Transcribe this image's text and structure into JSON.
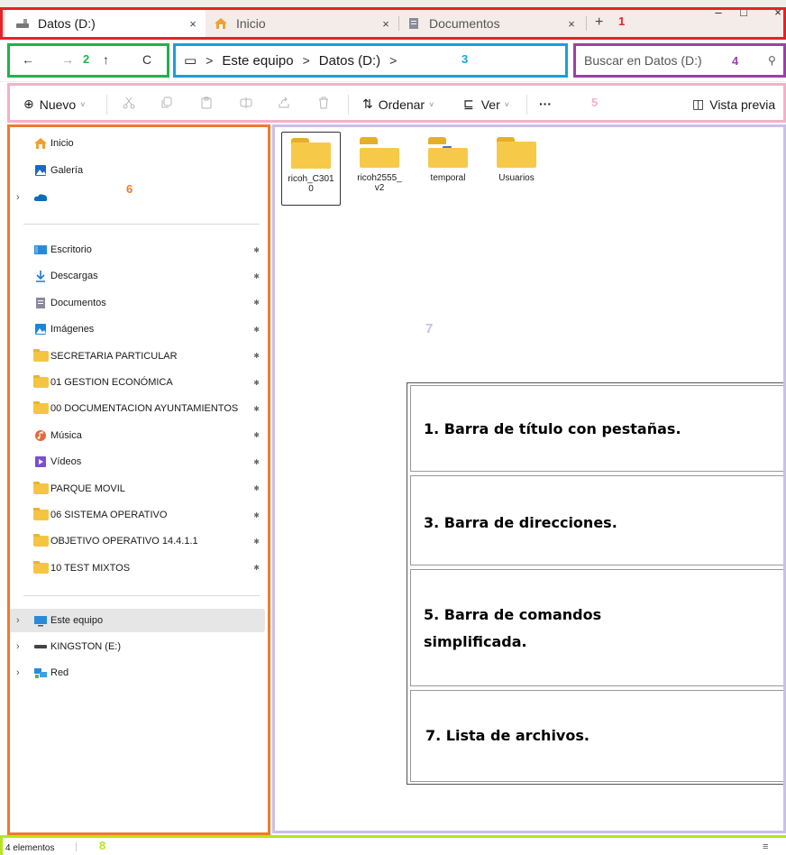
{
  "tabs": [
    {
      "label": "Datos (D:)",
      "close": "×"
    },
    {
      "label": "Inicio",
      "close": "×"
    },
    {
      "label": "Documentos",
      "close": "×"
    }
  ],
  "new_tab": "+",
  "window_controls": {
    "minimize": "–",
    "maximize": "□",
    "close": "×"
  },
  "nav": {
    "back": "←",
    "forward": "→",
    "up": "↑",
    "refresh": "C"
  },
  "address": {
    "computer_icon": "▭",
    "crumbs": [
      "Este equipo",
      "Datos (D:)"
    ],
    "sep": ">"
  },
  "search": {
    "placeholder": "Buscar en Datos (D:)",
    "icon": "⚲"
  },
  "commands": {
    "new": "Nuevo",
    "new_icon": "⊕",
    "sort": "Ordenar",
    "sort_icon": "⇅",
    "view": "Ver",
    "view_icon": "⊑",
    "more": "···",
    "preview": "Vista previa",
    "preview_icon": "◫",
    "caret": "˅"
  },
  "sidebar": {
    "top": [
      {
        "label": "Inicio",
        "icon": "home-icon"
      },
      {
        "label": "Galería",
        "icon": "gallery-icon"
      },
      {
        "label": "",
        "icon": "onedrive-icon"
      }
    ],
    "pinned": [
      {
        "label": "Escritorio",
        "icon": "desktop-icon"
      },
      {
        "label": "Descargas",
        "icon": "download-icon"
      },
      {
        "label": "Documentos",
        "icon": "documents-icon"
      },
      {
        "label": "Imágenes",
        "icon": "pictures-icon"
      },
      {
        "label": "SECRETARIA PARTICULAR",
        "icon": "folder-icon"
      },
      {
        "label": "01 GESTION ECONÓMICA",
        "icon": "folder-icon"
      },
      {
        "label": "00 DOCUMENTACION AYUNTAMIENTOS",
        "icon": "folder-icon"
      },
      {
        "label": "Música",
        "icon": "music-icon"
      },
      {
        "label": "Vídeos",
        "icon": "videos-icon"
      },
      {
        "label": "PARQUE MOVIL",
        "icon": "folder-icon"
      },
      {
        "label": "06 SISTEMA OPERATIVO",
        "icon": "folder-icon"
      },
      {
        "label": "OBJETIVO OPERATIVO 14.4.1.1",
        "icon": "folder-icon"
      },
      {
        "label": "10 TEST MIXTOS",
        "icon": "folder-icon"
      }
    ],
    "devices": [
      {
        "label": "Este equipo",
        "icon": "computer-icon"
      },
      {
        "label": "KINGSTON (E:)",
        "icon": "drive-icon"
      },
      {
        "label": "Red",
        "icon": "network-icon"
      }
    ]
  },
  "files": [
    {
      "line1": "ricoh_C301",
      "line2": "0"
    },
    {
      "line1": "ricoh2555_",
      "line2": "v2"
    },
    {
      "line1": "temporal",
      "line2": ""
    },
    {
      "line1": "Usuarios",
      "line2": ""
    }
  ],
  "legend": [
    "1. Barra de título con pestañas.",
    "3. Barra de direcciones.",
    "5.  Barra  de  comandos",
    "simplificada.",
    "7. Lista de archivos."
  ],
  "status": {
    "count": "4 elementos",
    "view_icon": "≡"
  },
  "annotations": {
    "n1": "1",
    "n2": "2",
    "n3": "3",
    "n4": "4",
    "n5": "5",
    "n6": "6",
    "n7": "7",
    "n8": "8"
  },
  "colors": {
    "red": "#e8202a",
    "green": "#22b14c",
    "blue": "#16a0dc",
    "purple": "#9b3fa8",
    "pink": "#f4b0c8",
    "orange": "#f07a2a",
    "lavender": "#c8c0e8",
    "lime": "#b5e61d"
  }
}
